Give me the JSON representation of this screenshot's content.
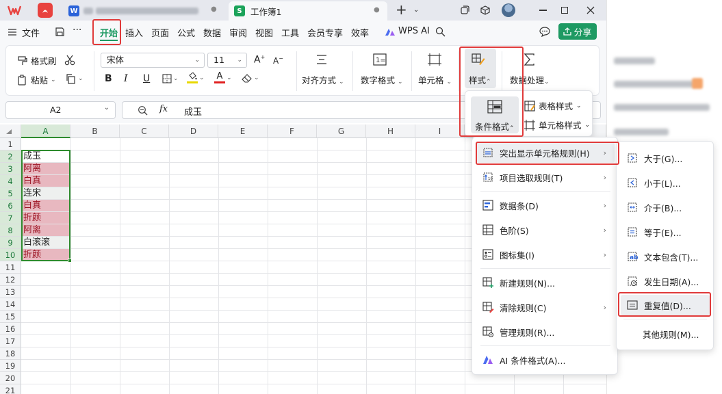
{
  "titlebar": {
    "tabs": [
      {
        "label": "",
        "active": false
      },
      {
        "label": "",
        "active": false
      },
      {
        "label": "工作簿1",
        "active": true
      }
    ],
    "new_tab": "+"
  },
  "menubar": {
    "file": "文件",
    "items": [
      "开始",
      "插入",
      "页面",
      "公式",
      "数据",
      "审阅",
      "视图",
      "工具",
      "会员专享",
      "效率"
    ],
    "active": "开始",
    "wps_ai": "WPS AI",
    "share": "分享"
  },
  "ribbon": {
    "format_painter": "格式刷",
    "paste": "粘贴",
    "font_name": "宋体",
    "font_size": "11",
    "align": "对齐方式",
    "number_format": "数字格式",
    "cell": "单元格",
    "style": "样式",
    "data_process": "数据处理"
  },
  "style_menu": {
    "conditional_format": "条件格式",
    "table_style": "表格样式",
    "cell_style": "单元格样式"
  },
  "formula_bar": {
    "name_box": "A2",
    "fx": "fx",
    "content": "成玉"
  },
  "grid": {
    "columns": [
      "A",
      "B",
      "C",
      "D",
      "E",
      "F",
      "G",
      "H",
      "I"
    ],
    "rows": [
      "1",
      "2",
      "3",
      "4",
      "5",
      "6",
      "7",
      "8",
      "9",
      "10",
      "11",
      "12",
      "13",
      "14",
      "15",
      "16",
      "17",
      "18",
      "19",
      "20",
      "21"
    ],
    "cells_A": [
      {
        "row": 2,
        "value": "成玉",
        "dup": false
      },
      {
        "row": 3,
        "value": "阿离",
        "dup": true
      },
      {
        "row": 4,
        "value": "白真",
        "dup": true
      },
      {
        "row": 5,
        "value": "连宋",
        "dup": false
      },
      {
        "row": 6,
        "value": "白真",
        "dup": true
      },
      {
        "row": 7,
        "value": "折颜",
        "dup": true
      },
      {
        "row": 8,
        "value": "阿离",
        "dup": true
      },
      {
        "row": 9,
        "value": "白滚滚",
        "dup": false
      },
      {
        "row": 10,
        "value": "折颜",
        "dup": true
      }
    ],
    "dup_bg": "#e8b8c0",
    "dup_text": "#9b0f1f",
    "selection_color": "#2e8b2e"
  },
  "cf_menu": {
    "items": [
      "突出显示单元格规则(H)",
      "项目选取规则(T)",
      "数据条(D)",
      "色阶(S)",
      "图标集(I)",
      "新建规则(N)...",
      "清除规则(C)",
      "管理规则(R)...",
      "AI 条件格式(A)..."
    ]
  },
  "highlight_menu": {
    "items": [
      "大于(G)...",
      "小于(L)...",
      "介于(B)...",
      "等于(E)...",
      "文本包含(T)...",
      "发生日期(A)...",
      "重复值(D)...",
      "其他规则(M)..."
    ]
  },
  "colors": {
    "accent_green": "#1e9a63",
    "highlight_red": "#e03a3a",
    "wps_red": "#e8423f",
    "word_blue": "#2b63d9",
    "sheet_green": "#1ba35a"
  }
}
